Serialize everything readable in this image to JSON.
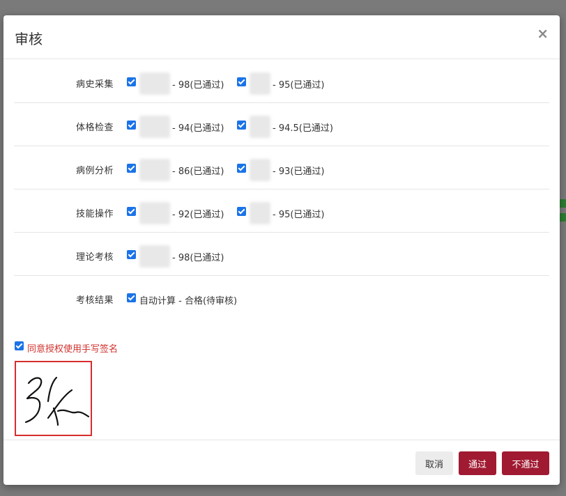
{
  "dialog": {
    "title": "审核"
  },
  "rows": [
    {
      "label": "病史采集",
      "items": [
        {
          "score": "- 98(已通过)"
        },
        {
          "score": "- 95(已通过)"
        }
      ]
    },
    {
      "label": "体格检查",
      "items": [
        {
          "score": "- 94(已通过)"
        },
        {
          "score": "- 94.5(已通过)"
        }
      ]
    },
    {
      "label": "病例分析",
      "items": [
        {
          "score": "- 86(已通过)"
        },
        {
          "score": "- 93(已通过)"
        }
      ]
    },
    {
      "label": "技能操作",
      "items": [
        {
          "score": "- 92(已通过)"
        },
        {
          "score": "- 95(已通过)"
        }
      ]
    },
    {
      "label": "理论考核",
      "items": [
        {
          "score": "- 98(已通过)"
        }
      ]
    },
    {
      "label": "考核结果",
      "items": [
        {
          "score": "自动计算 - 合格(待审核)"
        }
      ]
    }
  ],
  "consent": {
    "label": "同意授权使用手写签名",
    "checked": true
  },
  "footer": {
    "cancel": "取消",
    "pass": "通过",
    "reject": "不通过"
  },
  "colors": {
    "primary_button": "#a01a32",
    "consent_text": "#d0312d",
    "signature_border": "#d62d2d",
    "checkbox": "#1a73e8"
  }
}
